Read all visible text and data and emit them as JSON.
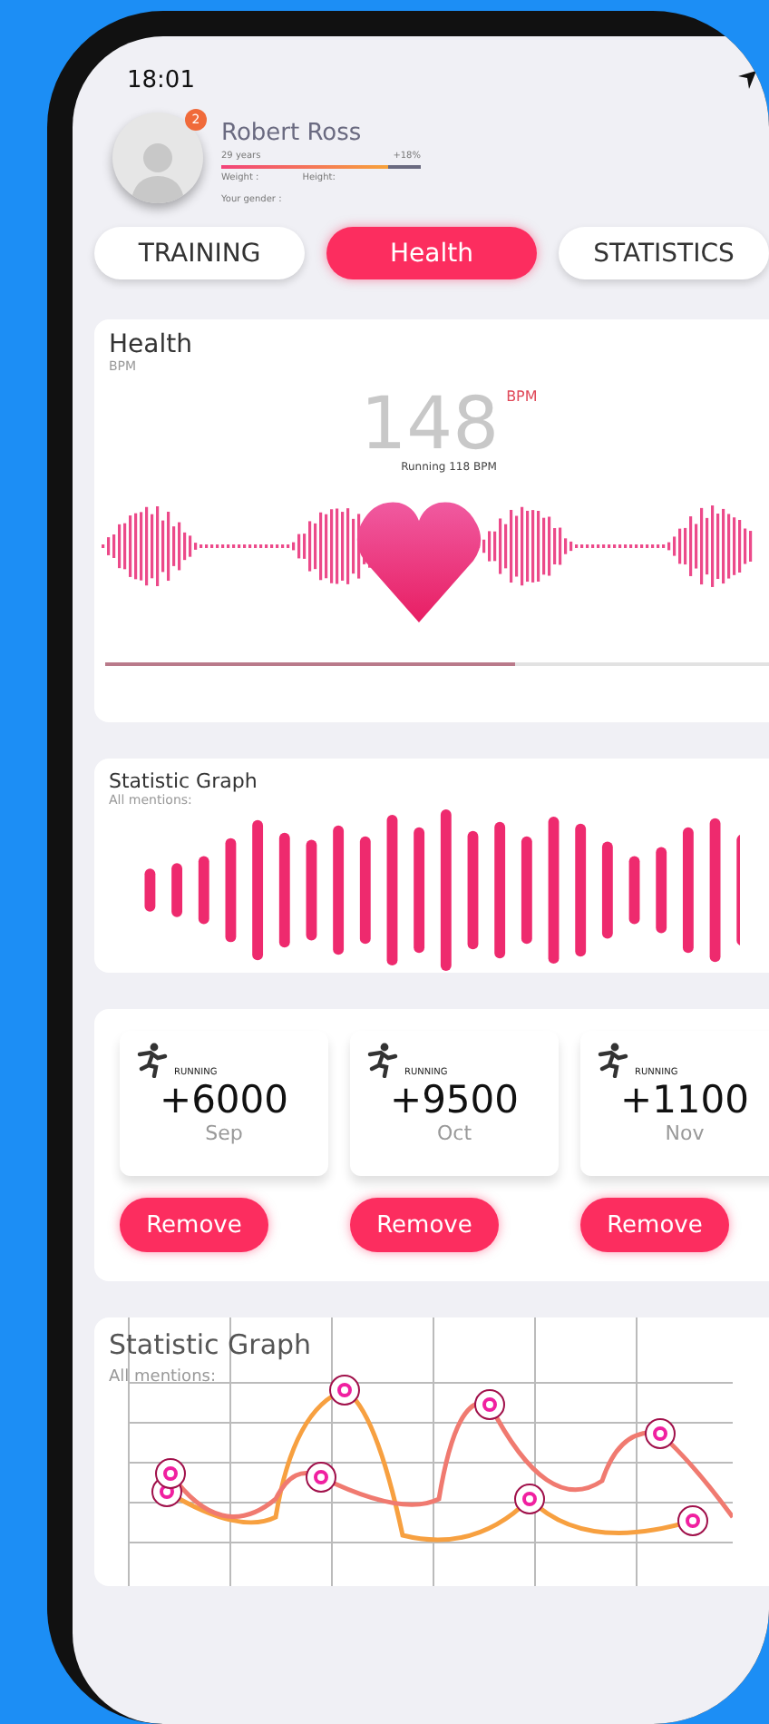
{
  "status_bar": {
    "time": "18:01"
  },
  "profile": {
    "name": "Robert Ross",
    "badge": "2",
    "age": "29 years",
    "change": "+18%",
    "level": 0.84,
    "weight_label": "Weight :",
    "height_label": "Height:",
    "gender_label": "Your gender :"
  },
  "tabs": [
    {
      "label": "TRAINING",
      "selected": false
    },
    {
      "label": "Health",
      "selected": true
    },
    {
      "label": "STATISTICS",
      "selected": false
    }
  ],
  "health": {
    "title": "Health",
    "subtitle": "BPM",
    "value": "148",
    "unit": "BPM",
    "caption": "Running 118 BPM",
    "level": 0.6
  },
  "statistic": {
    "title": "Statistic Graph",
    "subtitle": "All mentions:"
  },
  "running": [
    {
      "label": "RUNNING",
      "value": "+6000",
      "month": "Sep",
      "button": "Remove"
    },
    {
      "label": "RUNNING",
      "value": "+9500",
      "month": "Oct",
      "button": "Remove"
    },
    {
      "label": "RUNNING",
      "value": "+1100",
      "month": "Nov",
      "button": "Remove"
    }
  ],
  "graph": {
    "title": "Statistic Graph",
    "subtitle": "All mentions:"
  }
}
